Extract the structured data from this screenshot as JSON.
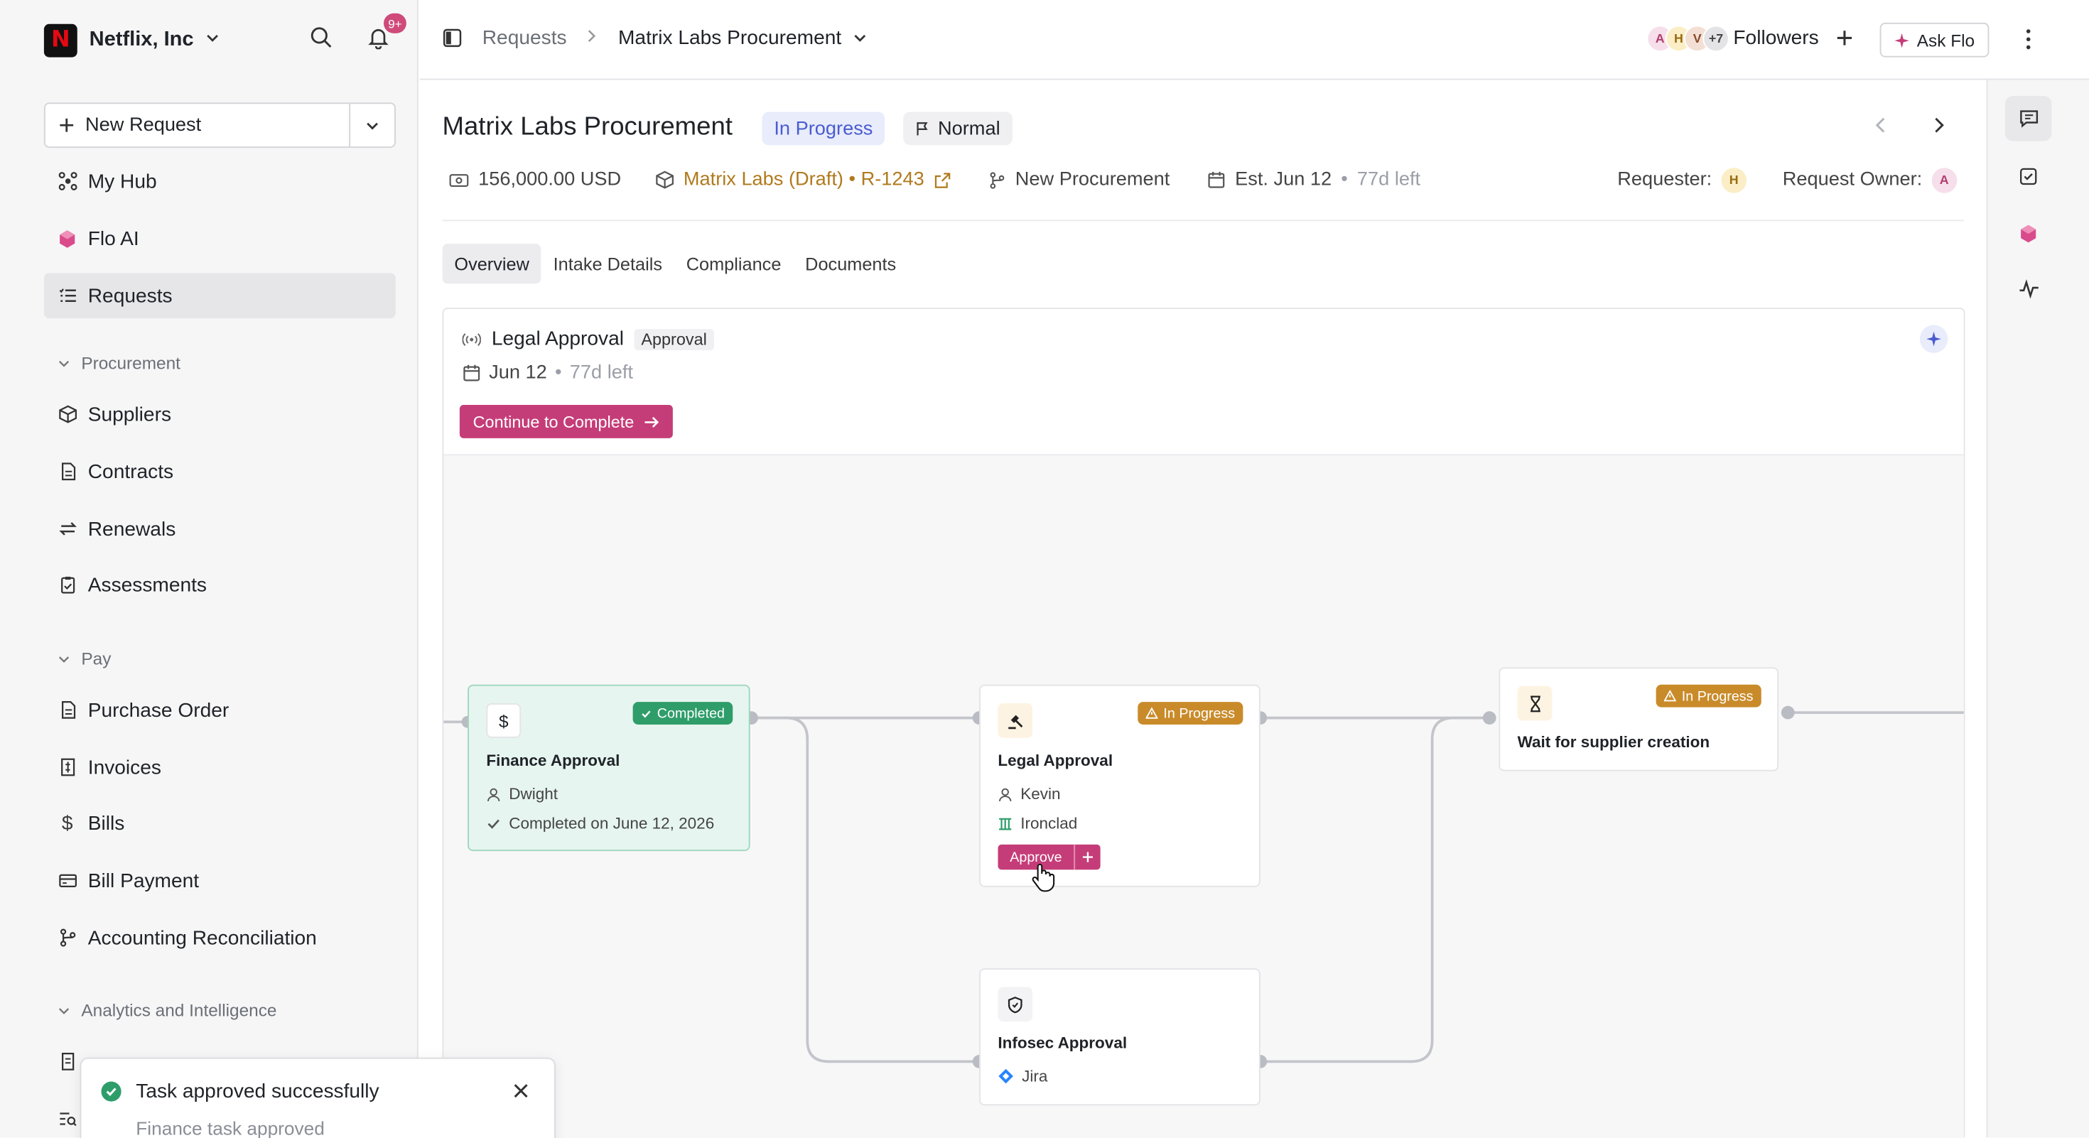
{
  "org": {
    "name": "Netflix, Inc",
    "logo_letter": "N",
    "notification_count": "9+"
  },
  "sidebar": {
    "new_request_label": "New Request",
    "top_items": [
      {
        "label": "My Hub",
        "icon": "hub-icon"
      },
      {
        "label": "Flo AI",
        "icon": "flo-ai-icon"
      },
      {
        "label": "Requests",
        "icon": "list-icon",
        "active": true
      }
    ],
    "sections": [
      {
        "label": "Procurement",
        "items": [
          "Suppliers",
          "Contracts",
          "Renewals",
          "Assessments"
        ]
      },
      {
        "label": "Pay",
        "items": [
          "Purchase Order",
          "Invoices",
          "Bills",
          "Bill Payment",
          "Accounting Reconciliation"
        ]
      },
      {
        "label": "Analytics and Intelligence",
        "items": []
      }
    ]
  },
  "breadcrumb": {
    "root": "Requests",
    "current": "Matrix Labs Procurement"
  },
  "header_actions": {
    "avatars": [
      {
        "letter": "A",
        "bg": "#f6dfea",
        "fg": "#b23d6f"
      },
      {
        "letter": "H",
        "bg": "#fbeec6",
        "fg": "#9a6b12"
      },
      {
        "letter": "V",
        "bg": "#f3dfd3",
        "fg": "#8a4a2b"
      },
      {
        "letter": "+7",
        "bg": "#e4e4e7",
        "fg": "#444444"
      }
    ],
    "followers_label": "Followers",
    "ask_flo_label": "Ask Flo"
  },
  "request": {
    "title": "Matrix Labs Procurement",
    "status": "In Progress",
    "priority": "Normal",
    "amount": "156,000.00 USD",
    "supplier_link": "Matrix Labs (Draft) • R-1243",
    "workflow": "New Procurement",
    "est_date": "Est. Jun 12",
    "time_left": "77d left",
    "requester_label": "Requester:",
    "requester_initial": "H",
    "owner_label": "Request Owner:",
    "owner_initial": "A"
  },
  "tabs": [
    "Overview",
    "Intake Details",
    "Compliance",
    "Documents"
  ],
  "active_tab": "Overview",
  "current_task": {
    "title": "Legal Approval",
    "tag": "Approval",
    "date": "Jun 12",
    "time_left": "77d left",
    "cta": "Continue to Complete"
  },
  "flow": {
    "finance": {
      "title": "Finance Approval",
      "status": "Completed",
      "person": "Dwight",
      "note": "Completed on June 12, 2026"
    },
    "legal": {
      "title": "Legal Approval",
      "status": "In Progress",
      "person": "Kevin",
      "system": "Ironclad",
      "approve_label": "Approve"
    },
    "supplier": {
      "title": "Wait for supplier creation",
      "status": "In Progress"
    },
    "infosec": {
      "title": "Infosec Approval",
      "system": "Jira"
    }
  },
  "toast": {
    "title": "Task approved successfully",
    "subtitle": "Finance task approved"
  },
  "colors": {
    "accent": "#c53d78",
    "completed": "#2f9d6a",
    "in_progress": "#c98b2a",
    "status_badge": "#4a5bcf"
  }
}
